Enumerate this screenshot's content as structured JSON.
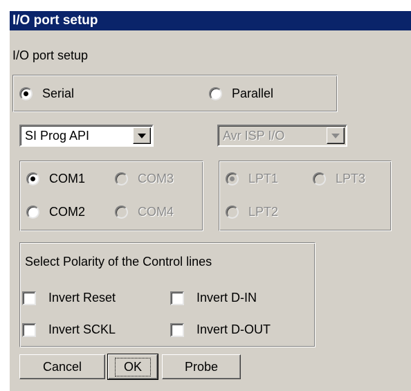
{
  "window": {
    "title": "I/O port setup"
  },
  "subtitle": "I/O port setup",
  "port_type": {
    "serial_label": "Serial",
    "parallel_label": "Parallel",
    "selected": "Serial"
  },
  "serial_combo": {
    "value": "SI Prog API",
    "enabled": true
  },
  "parallel_combo": {
    "value": "Avr ISP I/O",
    "enabled": false
  },
  "com_ports": {
    "com1": "COM1",
    "com2": "COM2",
    "com3": "COM3",
    "com4": "COM4",
    "selected": "COM1"
  },
  "lpt_ports": {
    "lpt1": "LPT1",
    "lpt2": "LPT2",
    "lpt3": "LPT3",
    "selected": "LPT1"
  },
  "polarity": {
    "heading": "Select Polarity of the Control lines",
    "invert_reset": "Invert Reset",
    "invert_din": "Invert D-IN",
    "invert_sckl": "Invert SCKL",
    "invert_dout": "Invert D-OUT"
  },
  "buttons": {
    "cancel": "Cancel",
    "ok": "OK",
    "probe": "Probe"
  },
  "colors": {
    "titlebar": "#0a246a",
    "face": "#d4d0c8",
    "disabled_text": "#8a8a8a"
  }
}
